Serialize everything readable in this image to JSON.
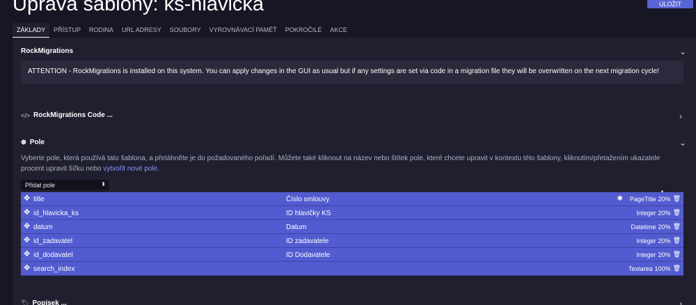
{
  "page": {
    "title": "Úprava šablony: ks-hlavička",
    "save_label": "ULOŽIT"
  },
  "tabs": [
    "ZÁKLADY",
    "PŘÍSTUP",
    "RODINA",
    "URL ADRESY",
    "SOUBORY",
    "VYROVNÁVACÍ PAMĚŤ",
    "POKROČILÉ",
    "AKCE"
  ],
  "rockmigrations": {
    "title": "RockMigrations",
    "alert": "ATTENTION - RockMigrations is installed on this system. You can apply changes in the GUI as usual but if any settings are set via code in a migration file they will be overwritten on the next migration cycle!"
  },
  "code_section": {
    "title": "RockMigrations Code ..."
  },
  "fields_section": {
    "title": "Pole",
    "desc_text": "Vyberte pole, která používá tato šablona, a přetáhněte je do požadovaného pořadí. Můžete také kliknout na název nebo štítek pole, které chcete upravit v kontextu této šablony, kliknutím/přetažením ukazatele procent upravit šířku nebo ",
    "desc_link": "vytvořit nové pole",
    "desc_end": ".",
    "add_select": "Přidat pole",
    "rows": [
      {
        "name": "title",
        "label": "Číslo smlouvy",
        "type": "PageTitle",
        "width": "20%",
        "cog": true
      },
      {
        "name": "id_hlavicka_ks",
        "label": "ID hlavičky KS",
        "type": "Integer",
        "width": "20%",
        "cog": false
      },
      {
        "name": "datum",
        "label": "Datum",
        "type": "Datetime",
        "width": "20%",
        "cog": false
      },
      {
        "name": "id_zadavatel",
        "label": "ID zadavatele",
        "type": "Integer",
        "width": "20%",
        "cog": false
      },
      {
        "name": "id_dodavatel",
        "label": "ID Dodavatele",
        "type": "Integer",
        "width": "20%",
        "cog": false
      },
      {
        "name": "search_index",
        "label": "",
        "type": "Textarea",
        "width": "100%",
        "cog": false
      }
    ]
  },
  "popisek_section": {
    "title": "Popisek ..."
  },
  "icons": {
    "move": "move-icon",
    "trash": "trash-icon",
    "cog": "cog-icon",
    "code": "code-icon",
    "cube": "cube-icon",
    "tag": "tag-icon"
  }
}
